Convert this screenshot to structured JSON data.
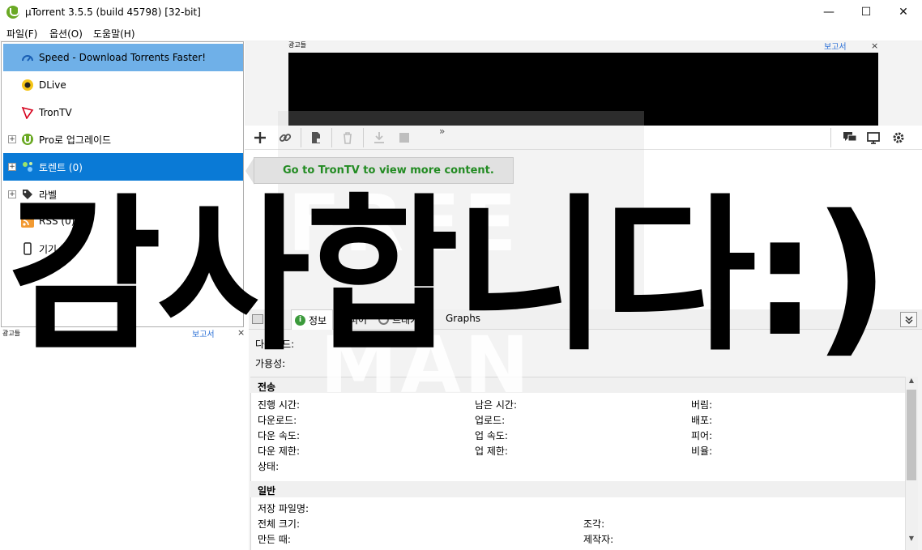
{
  "window": {
    "title": "µTorrent 3.5.5  (build 45798) [32-bit]",
    "controls": {
      "minimize": "—",
      "maximize": "☐",
      "close": "✕"
    }
  },
  "menu": [
    "파일(F)",
    "옵션(O)",
    "도움말(H)"
  ],
  "sidebar": {
    "items": [
      {
        "label": "Speed - Download Torrents Faster!",
        "icon": "speed-gauge-icon"
      },
      {
        "label": "DLive",
        "icon": "dlive-icon"
      },
      {
        "label": "TronTV",
        "icon": "tron-icon"
      },
      {
        "label": "Pro로 업그레이드",
        "icon": "utorrent-pro-icon"
      },
      {
        "label": "토렌트 (0)",
        "icon": "torrent-icon"
      },
      {
        "label": "라벨",
        "icon": "tag-icon"
      },
      {
        "label": "RSS (0)",
        "icon": "rss-icon"
      },
      {
        "label": "기기 목",
        "icon": "device-icon"
      }
    ]
  },
  "ads": {
    "label": "광고들",
    "report": "보고서",
    "close": "×"
  },
  "toolbar": {
    "buttons": [
      "add-torrent",
      "add-url",
      "create-torrent",
      "remove",
      "download",
      "stop"
    ],
    "more": "»",
    "right": [
      "chat",
      "remote",
      "settings"
    ]
  },
  "promo": {
    "text": "Go to TronTV to view more content."
  },
  "watermark": {
    "line1": "FREE",
    "line2": "MAN"
  },
  "overlay": {
    "text": "감사합니다:)"
  },
  "tabs": [
    {
      "label": "정보"
    },
    {
      "label": "피어"
    },
    {
      "label": "트래커"
    },
    {
      "label": "Graphs"
    }
  ],
  "info": {
    "downloaded_label": "다운로드:",
    "availability_label": "가용성:"
  },
  "transfer": {
    "heading": "전송",
    "col1": [
      "진행 시간:",
      "다운로드:",
      "다운 속도:",
      "다운 제한:",
      "상태:"
    ],
    "col2": [
      "남은 시간:",
      "업로드:",
      "업 속도:",
      "업 제한:"
    ],
    "col3": [
      "버림:",
      "배포:",
      "피어:",
      "비율:"
    ]
  },
  "general": {
    "heading": "일반",
    "rows": [
      "저장 파일명:",
      "전체 크기:",
      "만든 때:"
    ],
    "col2": [
      "조각:",
      "제작자:"
    ]
  },
  "colors": {
    "selected_blue": "#0a7ad6",
    "speed_highlight": "#6fb0e8",
    "promo_green": "#228b22",
    "ad_black": "#000000"
  }
}
